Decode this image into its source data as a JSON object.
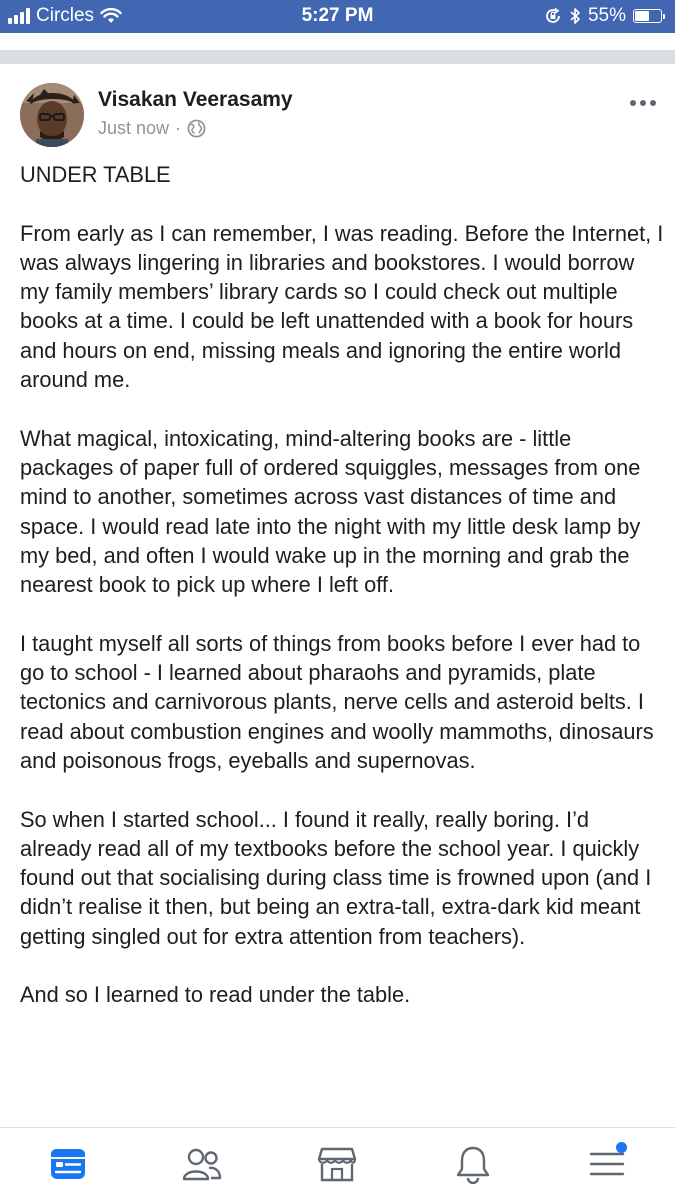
{
  "status_bar": {
    "carrier": "Circles",
    "time": "5:27 PM",
    "battery_percent": "55%",
    "battery_level": 0.55
  },
  "post": {
    "author": "Visakan Veerasamy",
    "timestamp": "Just now",
    "separator": "·",
    "privacy_icon": "globe-icon",
    "paragraphs": [
      "UNDER TABLE",
      "From early as I can remember, I was reading. Before the Internet, I was always lingering in libraries and bookstores. I would borrow my family members’ library cards so I could check out multiple books at a time. I could be left unattended with a book for hours and hours on end, missing meals and ignoring the entire world around me.",
      "What magical, intoxicating, mind-altering books are - little packages of paper full of ordered squiggles, messages from one mind to another, sometimes across vast distances of time and space. I would read late into the night with my little desk lamp by my bed, and often I would wake up in the morning and grab the nearest book to pick up where I left off.",
      "I taught myself all sorts of things from books before I ever had to go to school - I learned about pharaohs and pyramids, plate tectonics and carnivorous plants, nerve cells and asteroid belts. I read about combustion engines and woolly mammoths, dinosaurs and poisonous frogs, eyeballs and supernovas.",
      "So when I started school... I found it really, really boring. I’d already read all of my textbooks before the school year. I quickly found out that socialising during class time is frowned upon (and I didn’t realise it then, but being an extra-tall, extra-dark kid meant getting singled out for extra attention from teachers).",
      "And so I learned to read under the table."
    ]
  },
  "tab_bar": {
    "tabs": [
      {
        "icon": "news-feed-icon",
        "active": true
      },
      {
        "icon": "friends-icon",
        "active": false
      },
      {
        "icon": "marketplace-icon",
        "active": false
      },
      {
        "icon": "notifications-icon",
        "active": false
      },
      {
        "icon": "menu-icon",
        "active": false,
        "has_badge": true
      }
    ]
  },
  "colors": {
    "brand": "#4267b2",
    "active_tab": "#1877f2",
    "inactive_tab": "#606770",
    "meta_text": "#8d949e"
  }
}
